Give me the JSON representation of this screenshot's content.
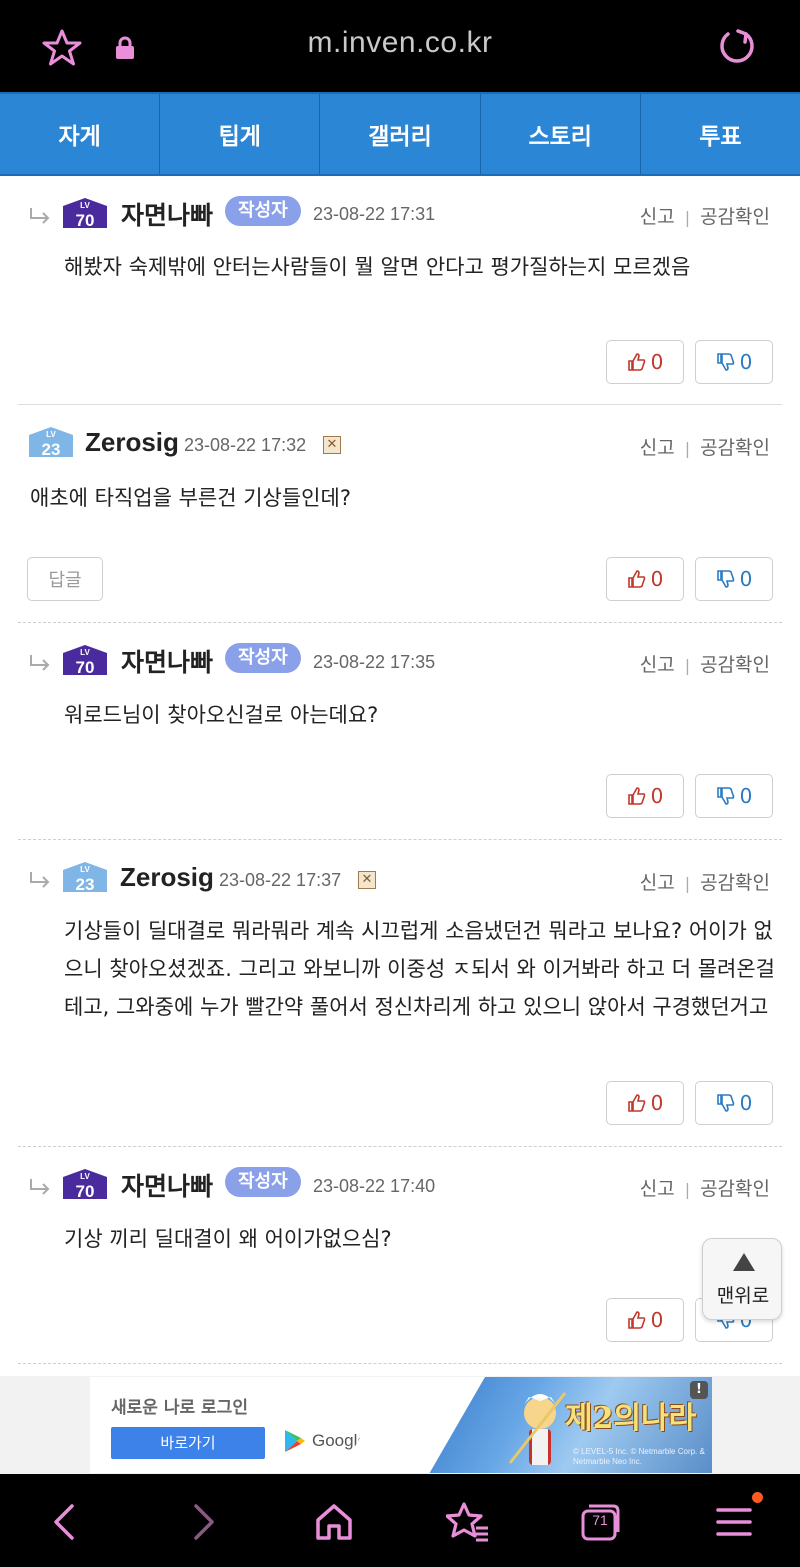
{
  "browser": {
    "url": "m.inven.co.kr",
    "accent": "#e98fd9"
  },
  "nav": {
    "tabs": [
      {
        "label": "자게"
      },
      {
        "label": "팁게"
      },
      {
        "label": "갤러리"
      },
      {
        "label": "스토리"
      },
      {
        "label": "투표"
      }
    ]
  },
  "labels": {
    "report": "신고",
    "sympathy": "공감확인",
    "reply": "답글",
    "author_badge": "작성자",
    "to_top": "맨위로"
  },
  "comments": [
    {
      "is_reply": true,
      "level": "70",
      "nickname": "자면나빠",
      "is_author": true,
      "date": "23-08-22 17:31",
      "body": "해봤자 숙제밖에 안터는사람들이 뭘 알면 안다고 평가질하는지 모르겠음",
      "upvotes": "0",
      "downvotes": "0"
    },
    {
      "is_reply": false,
      "level": "23",
      "nickname": "Zerosig",
      "is_author": false,
      "date": "23-08-22 17:32",
      "body": "애초에 타직업을 부른건 기상들인데?",
      "upvotes": "0",
      "downvotes": "0"
    },
    {
      "is_reply": true,
      "level": "70",
      "nickname": "자면나빠",
      "is_author": true,
      "date": "23-08-22 17:35",
      "body": "워로드님이 찾아오신걸로 아는데요?",
      "upvotes": "0",
      "downvotes": "0"
    },
    {
      "is_reply": true,
      "level": "23",
      "nickname": "Zerosig",
      "is_author": false,
      "date": "23-08-22 17:37",
      "body": "기상들이 딜대결로 뭐라뭐라 계속 시끄럽게 소음냈던건 뭐라고 보나요? 어이가 없으니 찾아오셨겠죠. 그리고 와보니까 이중성 ㅈ되서 와 이거봐라 하고 더 몰려온걸테고, 그와중에 누가 빨간약 풀어서 정신차리게 하고 있으니 앉아서 구경했던거고",
      "upvotes": "0",
      "downvotes": "0"
    },
    {
      "is_reply": true,
      "level": "70",
      "nickname": "자면나빠",
      "is_author": true,
      "date": "23-08-22 17:40",
      "body": "기상 끼리 딜대결이 왜 어이가없으심?",
      "upvotes": "0",
      "downvotes": "0"
    }
  ],
  "ad": {
    "tagline": "새로운 나로 로그인",
    "button": "바로가기",
    "store": "Google Play",
    "game_title": "제2의나라",
    "copyright": "© LEVEL-5 Inc. © Netmarble Corp. & Netmarble Neo Inc.",
    "info": "!"
  },
  "bottombar": {
    "tab_count": "71"
  }
}
